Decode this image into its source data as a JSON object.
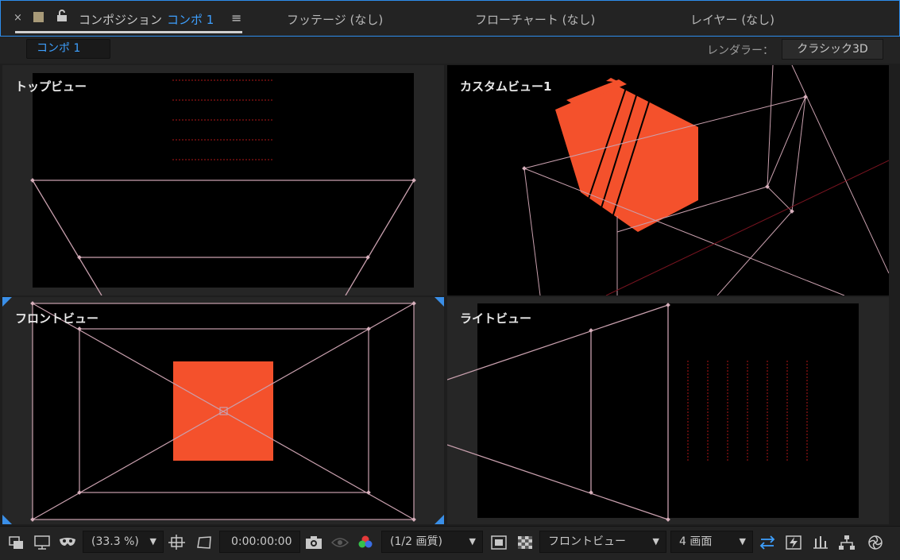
{
  "tabs": {
    "close_glyph": "×",
    "comp_prefix": "コンポジション",
    "comp_name": "コンポ 1",
    "menu_glyph": "≡",
    "footage": "フッテージ (なし)",
    "flowchart": "フローチャート (なし)",
    "layer": "レイヤー (なし)",
    "swatch_color": "#a89a78",
    "accent": "#2d8ceb"
  },
  "subbar": {
    "comp_breadcrumb": "コンポ 1",
    "renderer_label": "レンダラー：",
    "renderer_value": "クラシック3D"
  },
  "viewports": {
    "top_left": "トップビュー",
    "top_right": "カスタムビュー1",
    "bottom_left": "フロントビュー",
    "bottom_right": "ライトビュー",
    "layer_color": "#f4512c",
    "camera_line_color": "#c9a0ae"
  },
  "toolbar": {
    "zoom": "(33.3 %)",
    "timecode": "0:00:00:00",
    "resolution": "(1/2 画質)",
    "view": "フロントビュー",
    "layout": "4 画面"
  }
}
